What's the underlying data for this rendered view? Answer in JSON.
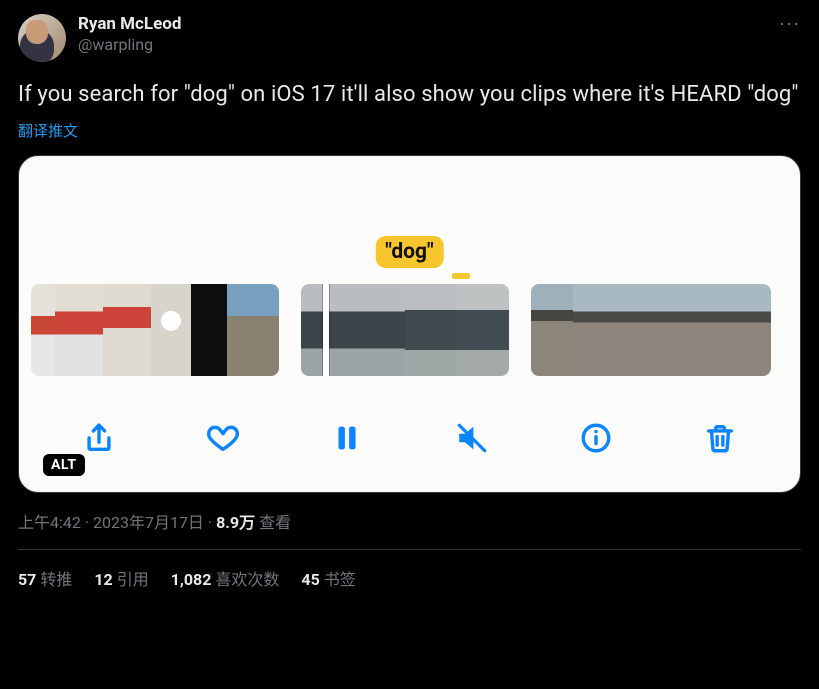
{
  "author": {
    "name": "Ryan McLeod",
    "handle": "@warpling"
  },
  "body": "If you search for \"dog\" on iOS 17 it'll also show you clips where it's HEARD \"dog\"",
  "translate_label": "翻译推文",
  "media": {
    "tag": "\"dog\"",
    "alt_badge": "ALT",
    "toolbar": {
      "share": "share-icon",
      "like": "heart-icon",
      "pause": "pause-icon",
      "mute": "mute-icon",
      "info": "info-icon",
      "trash": "trash-icon"
    }
  },
  "meta": {
    "time": "上午4:42",
    "sep1": " · ",
    "date": "2023年7月17日",
    "sep2": " · ",
    "views_count": "8.9万",
    "views_label": " 查看"
  },
  "stats": {
    "retweets": {
      "count": "57",
      "label": "转推"
    },
    "quotes": {
      "count": "12",
      "label": "引用"
    },
    "likes": {
      "count": "1,082",
      "label": "喜欢次数"
    },
    "bookmarks": {
      "count": "45",
      "label": "书签"
    }
  },
  "more_label": "···"
}
